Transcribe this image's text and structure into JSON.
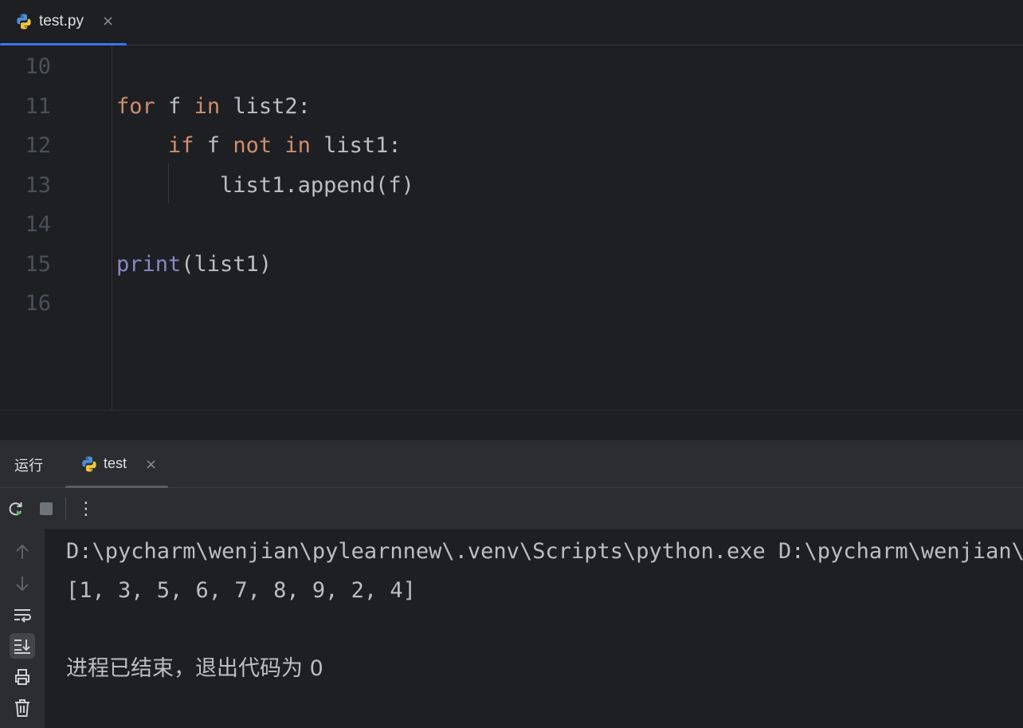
{
  "editor": {
    "tab_label": "test.py",
    "tab_close": "×",
    "line_numbers": [
      "10",
      "11",
      "12",
      "13",
      "14",
      "15",
      "16"
    ],
    "lines": [
      {
        "line": "10",
        "tokens": []
      },
      {
        "line": "11",
        "tokens": [
          {
            "text": "for",
            "kind": "kw"
          },
          {
            "text": " f ",
            "kind": "plain"
          },
          {
            "text": "in",
            "kind": "kw"
          },
          {
            "text": " list2:",
            "kind": "plain"
          }
        ]
      },
      {
        "line": "12",
        "tokens": [
          {
            "text": "    ",
            "kind": "plain"
          },
          {
            "text": "if",
            "kind": "kw"
          },
          {
            "text": " f ",
            "kind": "plain"
          },
          {
            "text": "not",
            "kind": "kw"
          },
          {
            "text": " ",
            "kind": "plain"
          },
          {
            "text": "in",
            "kind": "kw"
          },
          {
            "text": " list1:",
            "kind": "plain"
          }
        ]
      },
      {
        "line": "13",
        "tokens": [
          {
            "text": "        list1.append(f)",
            "kind": "plain"
          }
        ]
      },
      {
        "line": "14",
        "tokens": []
      },
      {
        "line": "15",
        "tokens": [
          {
            "text": "print",
            "kind": "fn"
          },
          {
            "text": "(list1)",
            "kind": "plain"
          }
        ]
      },
      {
        "line": "16",
        "tokens": []
      }
    ]
  },
  "run_panel": {
    "title": "运行",
    "tab_label": "test",
    "tab_close": "×",
    "toolbar": {
      "rerun_icon": "rerun-icon",
      "stop_icon": "stop-icon",
      "more_label": "⋮"
    },
    "side_buttons": [
      "arrow-up-icon",
      "arrow-down-icon",
      "soft-wrap-icon",
      "scroll-to-end-icon",
      "print-icon",
      "trash-icon"
    ]
  },
  "console": {
    "command": "D:\\pycharm\\wenjian\\pylearnnew\\.venv\\Scripts\\python.exe D:\\pycharm\\wenjian\\pylearnnew\\test.py",
    "output": "[1, 3, 5, 6, 7, 8, 9, 2, 4]",
    "exit_message": "进程已结束，退出代码为 0"
  },
  "colors": {
    "background": "#1e1f22",
    "panel": "#2b2d30",
    "keyword": "#cf8e6d",
    "builtin": "#8888c6",
    "text": "#bcbec4",
    "accent": "#3574f0"
  }
}
